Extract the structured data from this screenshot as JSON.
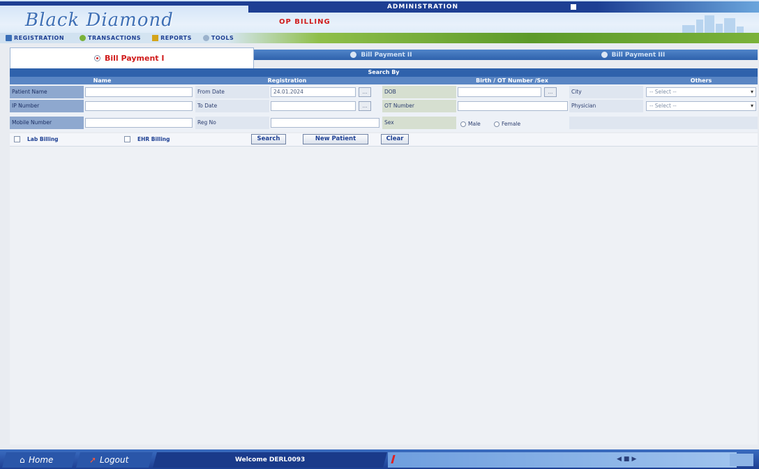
{
  "header": {
    "logo_text": "Black Diamond",
    "admin_label": "ADMINISTRATION",
    "page_heading": "OP BILLING"
  },
  "menu": {
    "items": [
      {
        "label": "REGISTRATION",
        "icon": "registration-icon"
      },
      {
        "label": "TRANSACTIONS",
        "icon": "transactions-icon"
      },
      {
        "label": "REPORTS",
        "icon": "reports-icon"
      },
      {
        "label": "TOOLS",
        "icon": "tools-icon"
      }
    ]
  },
  "tabs": [
    {
      "label": "Bill Payment I",
      "active": true
    },
    {
      "label": "Bill Payment II",
      "active": false
    },
    {
      "label": "Bill Payment III",
      "active": false
    }
  ],
  "search": {
    "title": "Search By",
    "columns": {
      "name": "Name",
      "registration": "Registration",
      "birth": "Birth / OT Number /Sex",
      "others": "Others"
    },
    "labels": {
      "patient_name": "Patient Name",
      "ip_number": "IP Number",
      "mobile_number": "Mobile Number",
      "from_date": "From Date",
      "to_date": "To Date",
      "reg_no": "Reg No",
      "dob": "DOB",
      "ot_number": "OT Number",
      "sex": "Sex",
      "city": "City",
      "physician": "Physician"
    },
    "values": {
      "patient_name": "",
      "ip_number": "",
      "mobile_number": "",
      "from_date": "24.01.2024",
      "to_date": "",
      "reg_no": "",
      "dob": "",
      "ot_number": ""
    },
    "sex_options": [
      "Male",
      "Female"
    ],
    "selects": {
      "city": "-- Select --",
      "physician": "-- Select --"
    },
    "calendar_btn": "..."
  },
  "actions": {
    "lab_billing": "Lab Billing",
    "ehr_billing": "EHR Billing",
    "search": "Search",
    "new_patient": "New Patient",
    "clear": "Clear"
  },
  "taskbar": {
    "home": "Home",
    "logout": "Logout",
    "welcome": "Welcome DERL0093"
  }
}
